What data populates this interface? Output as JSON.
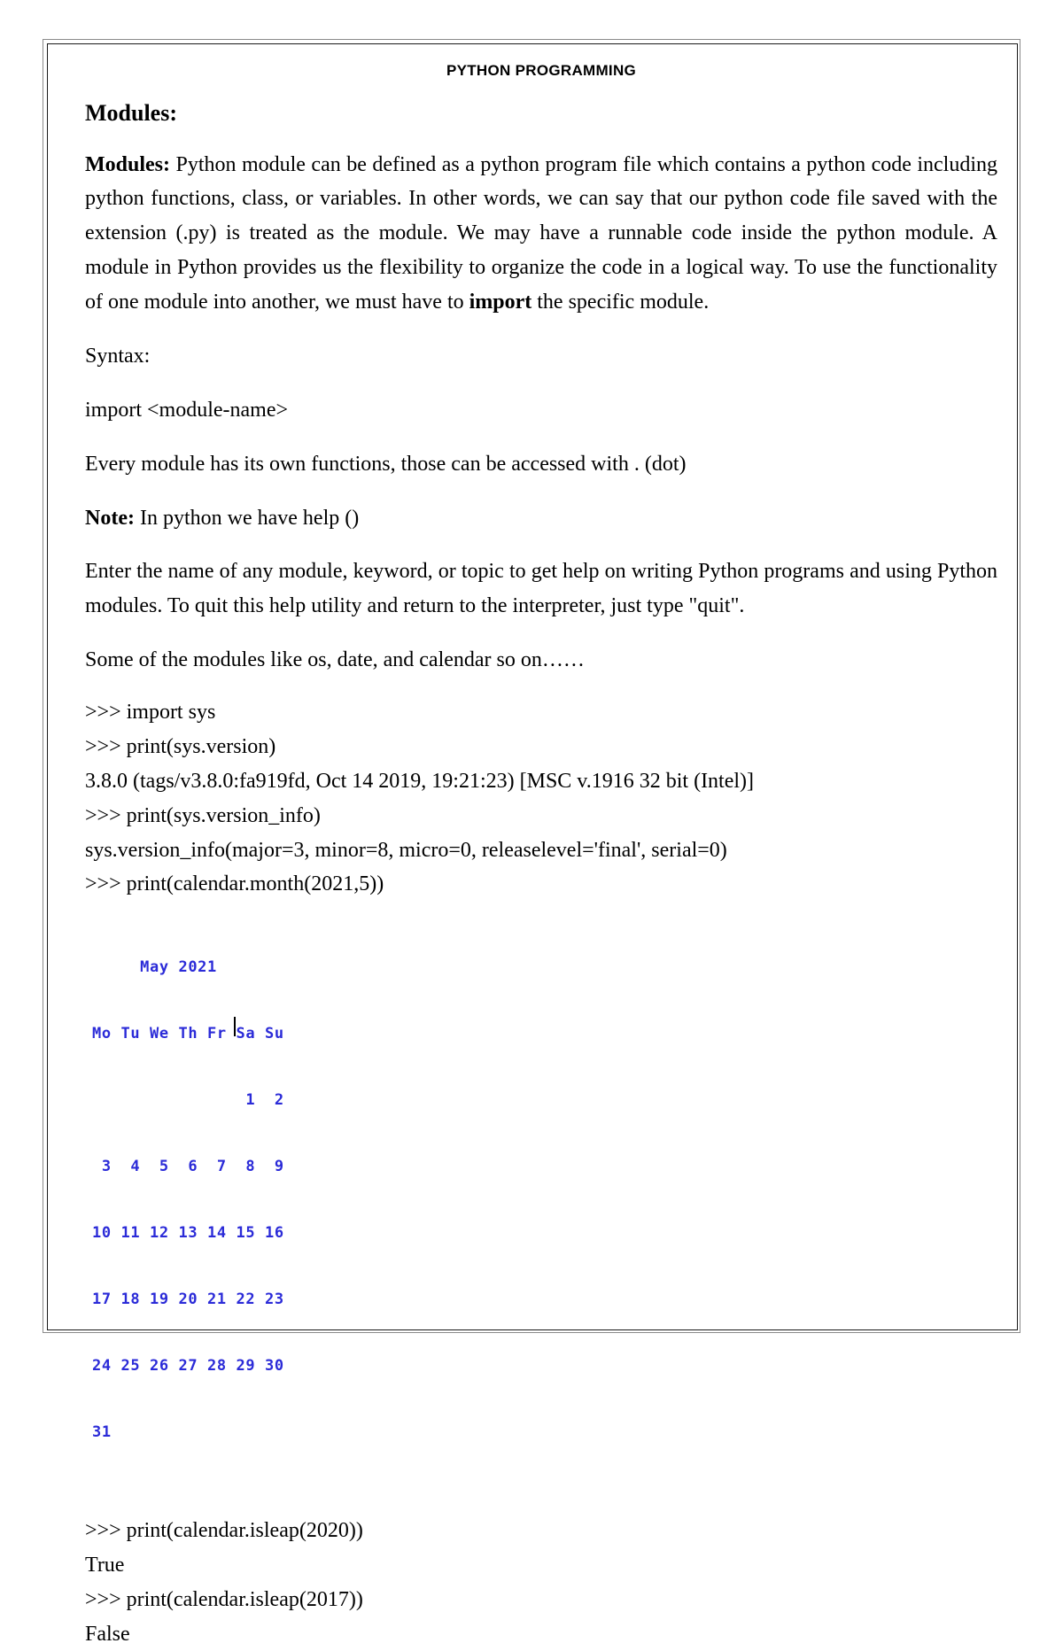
{
  "page": {
    "running_header": "PYTHON PROGRAMMING"
  },
  "headings": {
    "modules": "Modules:"
  },
  "paragraphs": {
    "modules_label": "Modules:",
    "modules_body_1": " Python module can be defined as a python program file which contains a python code including python functions, class, or variables. In other words, we can say that our python code file saved with the extension (.py) is treated as the module. We may have a runnable code inside the python module. A module in Python provides us the flexibility to organize the code in a logical way. To use the functionality of one module into another, we must have to ",
    "import_bold": "import",
    "modules_body_2": " the specific module.",
    "syntax_label": "Syntax:",
    "syntax_code": "import  <module-name>",
    "dot_access": "Every module has its own functions, those can be accessed with  . (dot)",
    "note_label": "Note:",
    "note_body": " In python we have help ()",
    "help_text": "Enter the name of any module, keyword, or topic to get help on writing Python programs and using Python modules.  To quit this help utility and return to the interpreter, just type \"quit\".",
    "some_modules": "Some of the modules like os, date, and calendar so on……"
  },
  "repl": {
    "line_1": ">>> import sys",
    "line_2": ">>> print(sys.version)",
    "line_3": "3.8.0 (tags/v3.8.0:fa919fd, Oct 14 2019, 19:21:23) [MSC v.1916 32 bit (Intel)]",
    "line_4": ">>> print(sys.version_info)",
    "line_5": "sys.version_info(major=3, minor=8, micro=0, releaselevel='final', serial=0)",
    "line_6": ">>> print(calendar.month(2021,5))",
    "line_7": ">>> print(calendar.isleap(2020))",
    "line_8": "True",
    "line_9": ">>> print(calendar.isleap(2017))",
    "line_10": "False"
  },
  "calendar_output": {
    "color": "#2b2bd8",
    "title": "     May 2021",
    "weekdays": "Mo Tu We Th Fr Sa Su",
    "week_1": "                1  2",
    "week_2": " 3  4  5  6  7  8  9",
    "week_3": "10 11 12 13 14 15 16",
    "week_4": "17 18 19 20 21 22 23",
    "week_5": "24 25 26 27 28 29 30",
    "week_6": "31"
  }
}
